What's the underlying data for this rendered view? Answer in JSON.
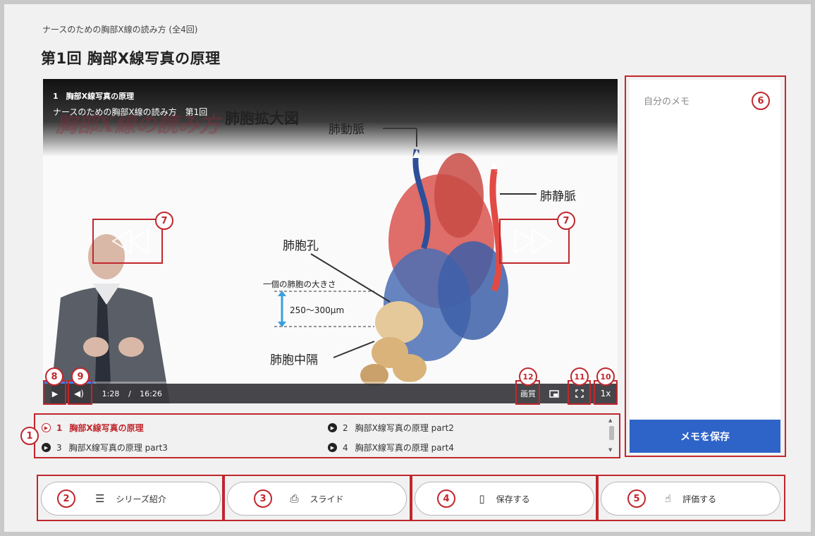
{
  "breadcrumb": "ナースのための胸部X線の読み方 (全4回)",
  "page_title": "第1回 胸部X線写真の原理",
  "video": {
    "episode_title": "1　胸部X線写真の原理",
    "series_line": "ナースのための胸部X線の読み方　第1回",
    "logo_watermark": "胸部X線の読み方",
    "slide": {
      "title": "肺胞拡大図",
      "label_artery": "肺動脈",
      "label_vein": "肺静脈",
      "label_pore": "肺胞孔",
      "label_size": "一個の肺胞の大きさ",
      "label_range": "250～300μm",
      "label_septum": "肺胞中隔"
    },
    "controls": {
      "current_time": "1:28",
      "separator": "/",
      "duration": "16:26",
      "progress_fraction": 0.09,
      "quality_label": "画質",
      "speed_label": "1x",
      "play_icon": "play-icon",
      "volume_icon": "volume-icon",
      "pip_icon": "picture-in-picture-icon",
      "fullscreen_icon": "fullscreen-icon"
    }
  },
  "playlist": [
    {
      "num": "1",
      "title": "胸部X線写真の原理",
      "active": true
    },
    {
      "num": "2",
      "title": "胸部X線写真の原理 part2",
      "active": false
    },
    {
      "num": "3",
      "title": "胸部X線写真の原理 part3",
      "active": false
    },
    {
      "num": "4",
      "title": "胸部X線写真の原理 part4",
      "active": false
    }
  ],
  "memo": {
    "placeholder": "自分のメモ",
    "save_label": "メモを保存"
  },
  "actions": [
    {
      "label": "シリーズ紹介",
      "icon": "document-list-icon"
    },
    {
      "label": "スライド",
      "icon": "pdf-file-icon"
    },
    {
      "label": "保存する",
      "icon": "bookmark-icon"
    },
    {
      "label": "評価する",
      "icon": "thumbs-up-icon"
    }
  ],
  "annotations": {
    "n1": "1",
    "n2": "2",
    "n3": "3",
    "n4": "4",
    "n5": "5",
    "n6": "6",
    "n7": "7",
    "n8": "8",
    "n9": "9",
    "n10": "10",
    "n11": "11",
    "n12": "12"
  },
  "colors": {
    "annotation_red": "#c0272d",
    "save_blue": "#2e63c8",
    "progress_blue": "#3b82f6"
  }
}
